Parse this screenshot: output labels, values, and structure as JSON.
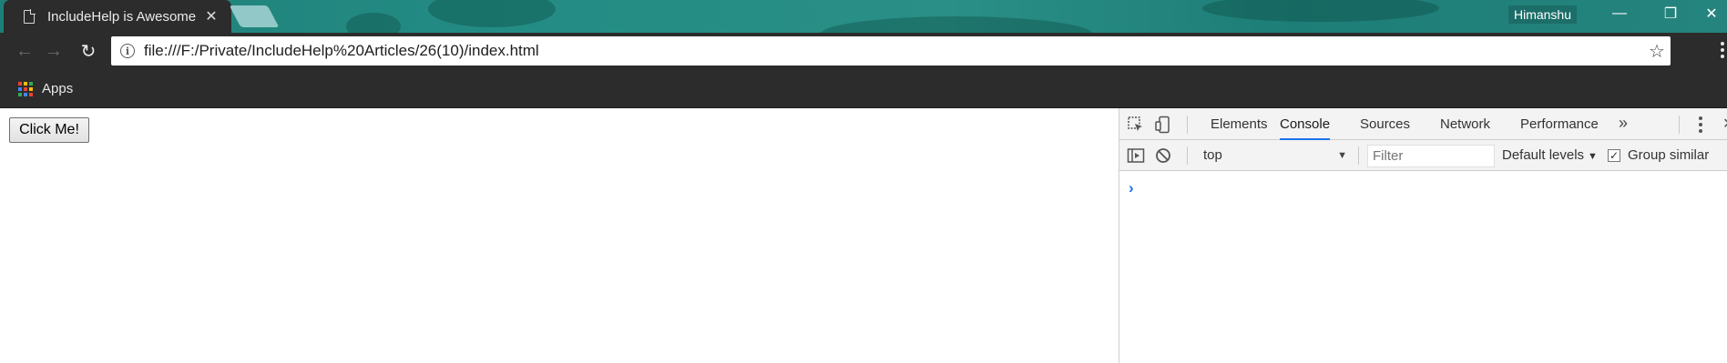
{
  "browser": {
    "tab": {
      "title": "IncludeHelp is Awesome",
      "close_glyph": "✕"
    },
    "profile_name": "Himanshu",
    "window_controls": {
      "minimize": "—",
      "restore": "❐",
      "close": "✕"
    },
    "nav": {
      "back": "←",
      "forward": "→",
      "reload": "↻"
    },
    "address": {
      "info_glyph": "i",
      "url": "file:///F:/Private/IncludeHelp%20Articles/26(10)/index.html",
      "star_glyph": "☆"
    },
    "bookmarks": {
      "apps_label": "Apps",
      "apps_colors": [
        "#ea4335",
        "#fbbc05",
        "#34a853",
        "#4285f4",
        "#ea4335",
        "#fbbc05",
        "#34a853",
        "#4285f4",
        "#ea4335"
      ]
    }
  },
  "page": {
    "button_label": "Click Me!"
  },
  "devtools": {
    "tabs": [
      {
        "label": "Elements",
        "active": false
      },
      {
        "label": "Console",
        "active": true
      },
      {
        "label": "Sources",
        "active": false
      },
      {
        "label": "Network",
        "active": false
      },
      {
        "label": "Performance",
        "active": false
      }
    ],
    "more_glyph": "»",
    "console": {
      "context_value": "top",
      "filter_placeholder": "Filter",
      "levels_label": "Default levels",
      "group_similar_label": "Group similar",
      "group_similar_checked": true,
      "prompt_glyph": "›"
    },
    "accent_color": "#1a73e8"
  }
}
